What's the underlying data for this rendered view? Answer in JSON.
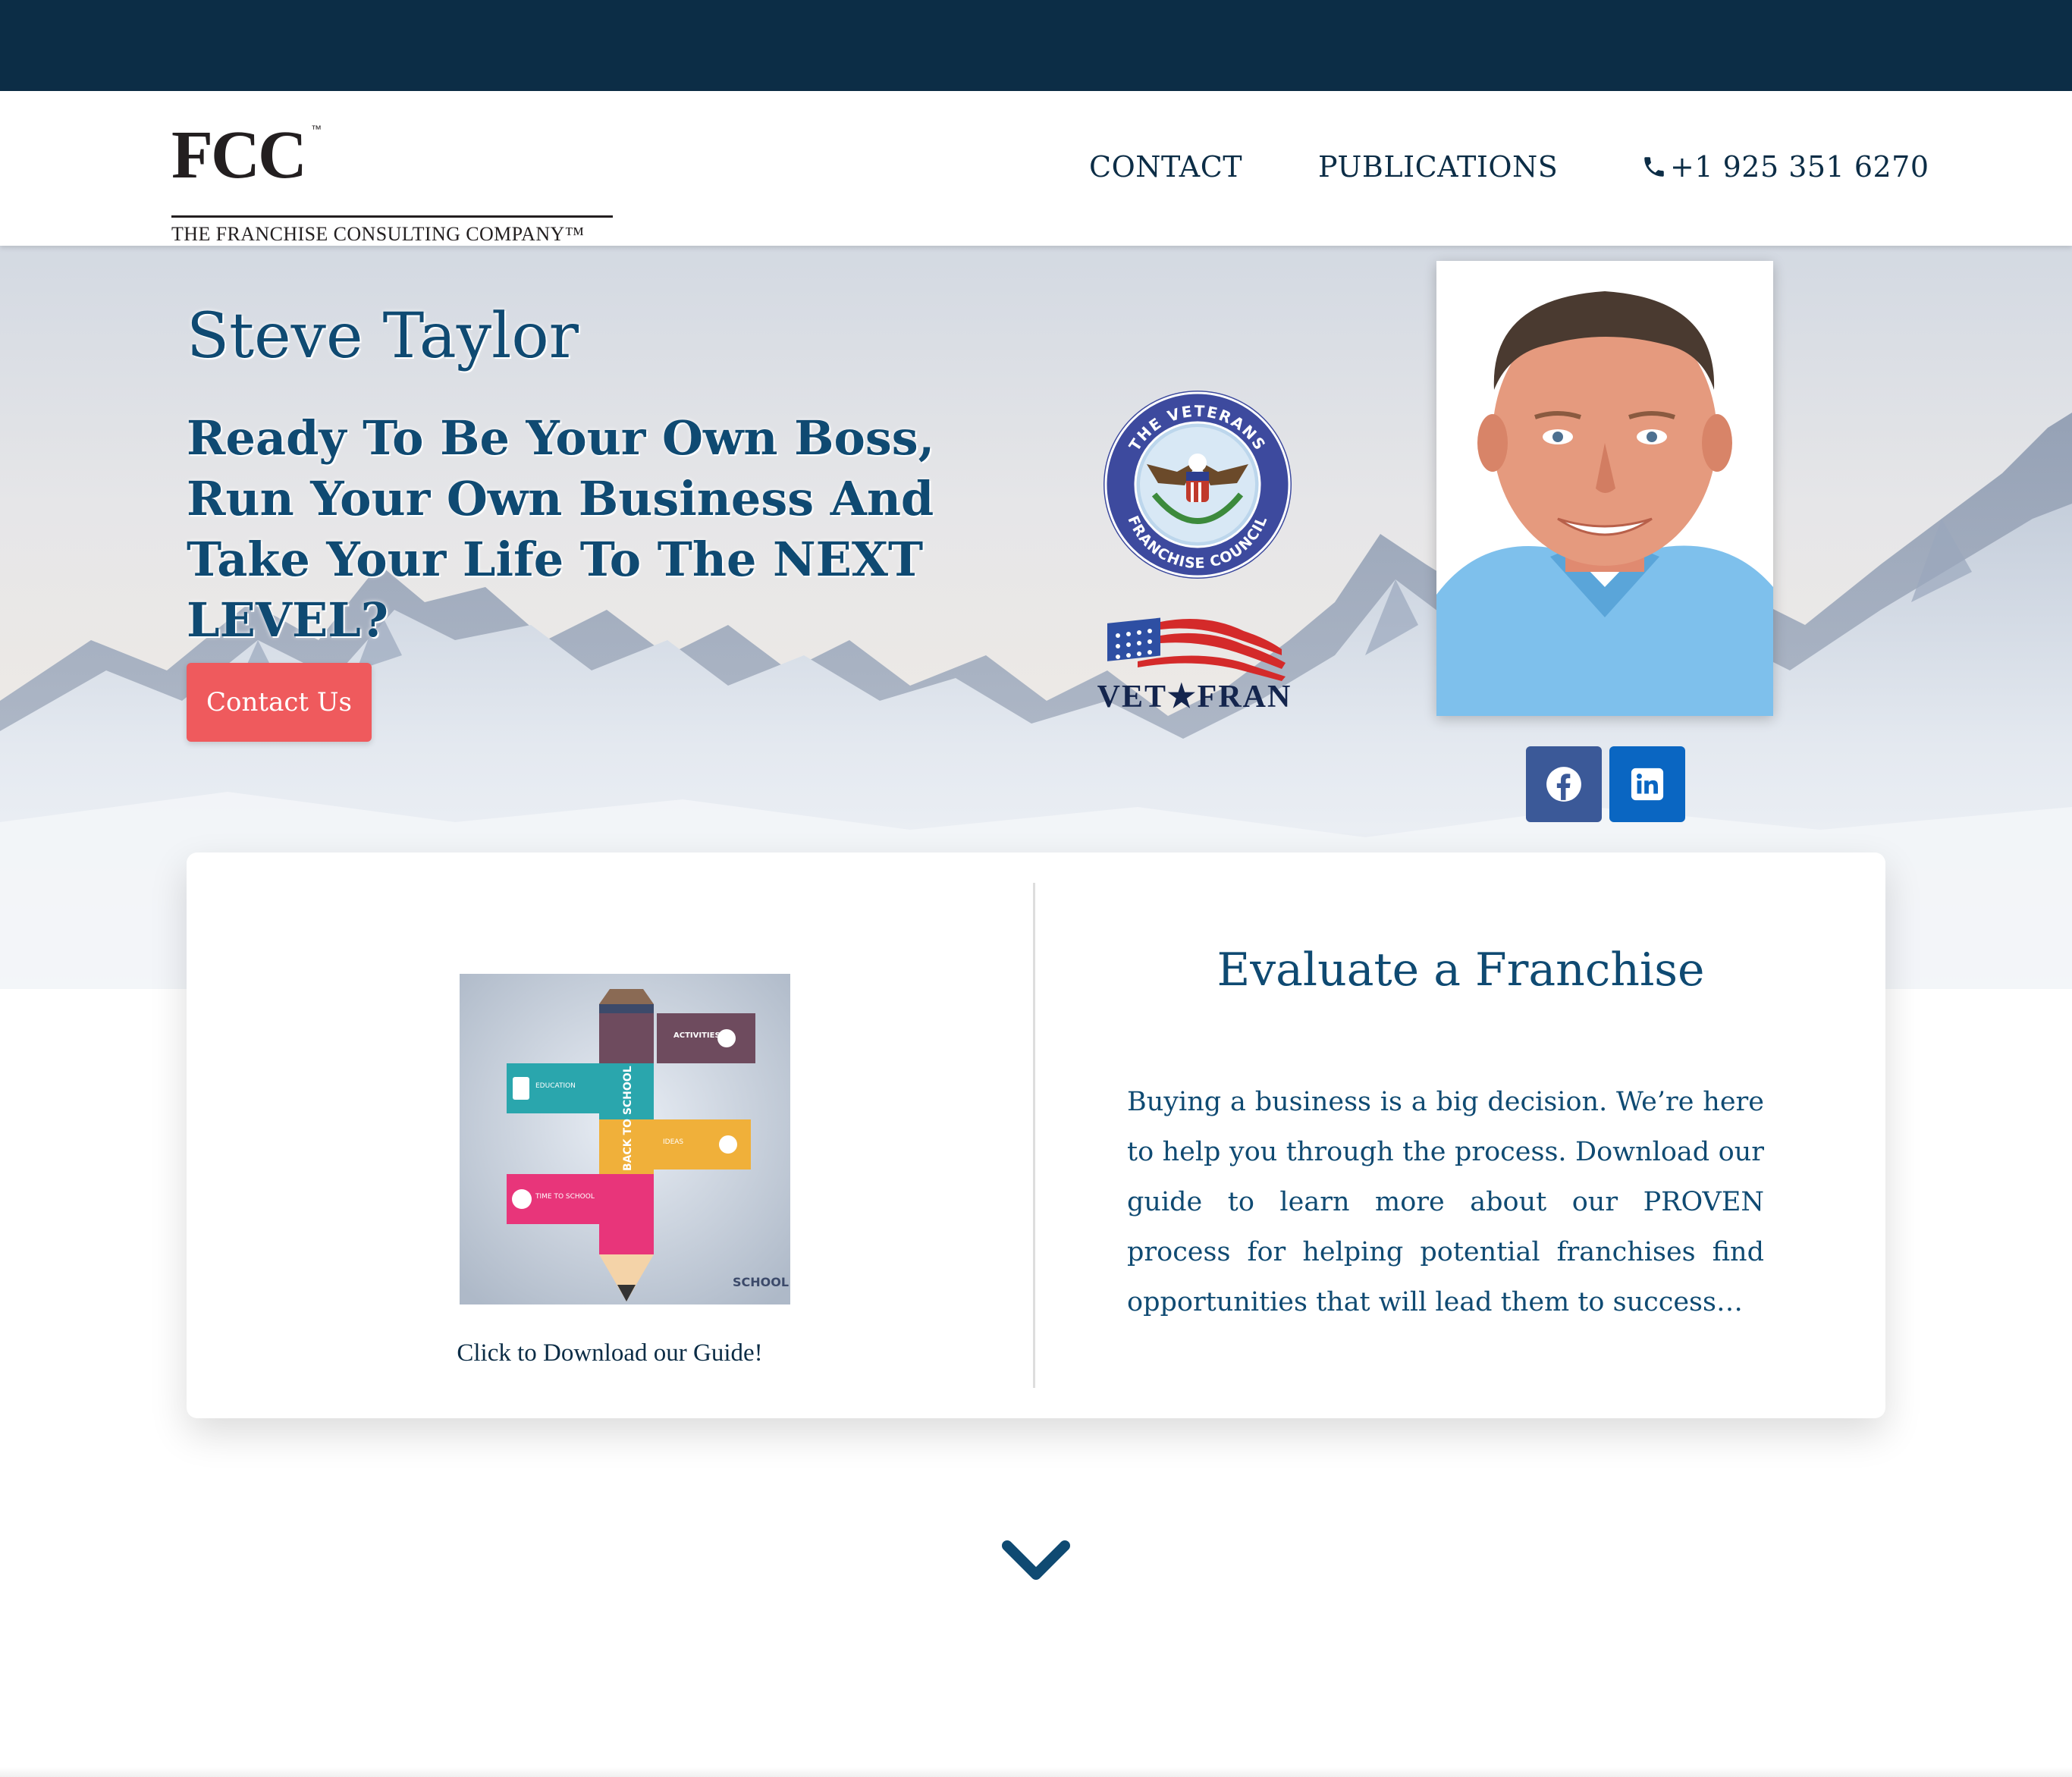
{
  "header": {
    "logo": {
      "mark": "FCC",
      "tm": "™",
      "subtitle": "THE FRANCHISE CONSULTING COMPANY™"
    },
    "nav": {
      "contact": "CONTACT",
      "publications": "PUBLICATIONS",
      "phone": "+1 925 351 6270"
    }
  },
  "hero": {
    "name": "Steve Taylor",
    "tagline": "Ready To Be Your Own Boss, Run Your Own Business And Take Your Life To The NEXT LEVEL?",
    "cta_label": "Contact Us",
    "badges": {
      "vfc_top": "THE VETERANS",
      "vfc_bottom": "FRANCHISE COUNCIL",
      "vetfran": "VET★FRAN"
    },
    "social": [
      "facebook-icon",
      "linkedin-icon"
    ]
  },
  "card": {
    "guide_caption": "Click to Download our Guide!",
    "guide_image_labels": {
      "activities": "ACTIVITIES",
      "education": "EDUCATION",
      "ideas": "IDEAS",
      "time": "TIME TO SCHOOL",
      "pencil": "BACK TO SCHOOL",
      "corner": "SCHOOL"
    },
    "title": "Evaluate a Franchise",
    "text": "Buying a business is a big decision. We’re here to help you through the process. Download our guide to learn more about our PROVEN process for helping potential franchises find opportunities that will lead them to success…"
  },
  "colors": {
    "navy": "#0c2d46",
    "heading_blue": "#0f4a72",
    "cta_red": "#ef5a5d",
    "facebook": "#3b5998",
    "linkedin": "#0a66c2"
  }
}
